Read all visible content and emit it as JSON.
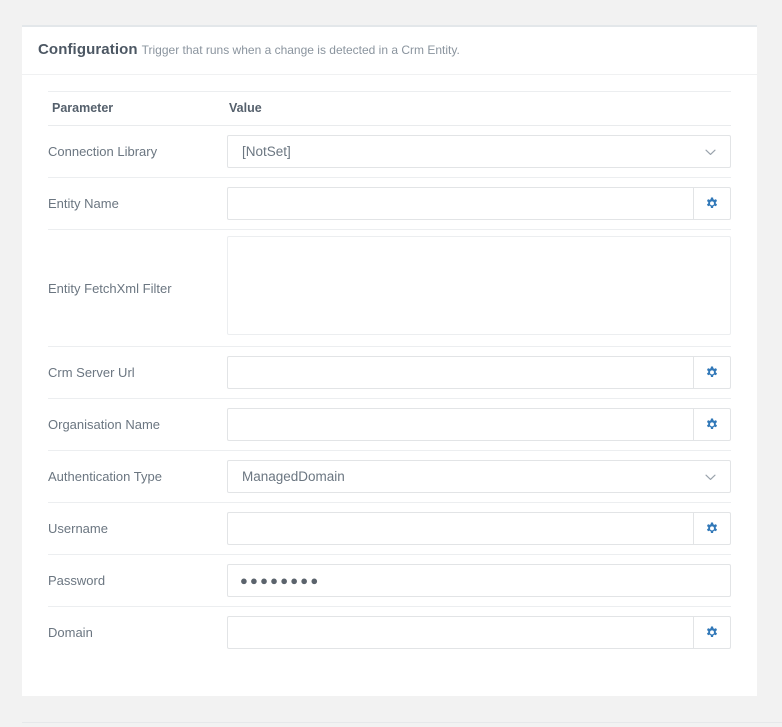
{
  "panel": {
    "title": "Configuration",
    "subtitle": "Trigger that runs when a change is detected in a Crm Entity."
  },
  "table": {
    "headers": {
      "parameter": "Parameter",
      "value": "Value"
    },
    "rows": [
      {
        "label": "Connection Library",
        "control": "select",
        "value": "[NotSet]",
        "icon": "chevron-down-icon"
      },
      {
        "label": "Entity Name",
        "control": "input-with-button",
        "value": "",
        "placeholder": "",
        "icon": "gear-icon"
      },
      {
        "label": "Entity FetchXml Filter",
        "control": "textarea",
        "value": "",
        "placeholder": ""
      },
      {
        "label": "Crm Server Url",
        "control": "input-with-button",
        "value": "",
        "placeholder": "",
        "icon": "gear-icon"
      },
      {
        "label": "Organisation Name",
        "control": "input-with-button",
        "value": "",
        "placeholder": "",
        "icon": "gear-icon"
      },
      {
        "label": "Authentication Type",
        "control": "select",
        "value": "ManagedDomain",
        "icon": "chevron-down-icon"
      },
      {
        "label": "Username",
        "control": "input-with-button",
        "value": "",
        "placeholder": "",
        "icon": "gear-icon"
      },
      {
        "label": "Password",
        "control": "password",
        "value": "●●●●●●●●"
      },
      {
        "label": "Domain",
        "control": "input-with-button",
        "value": "",
        "placeholder": "",
        "icon": "gear-icon"
      }
    ]
  },
  "colors": {
    "page_background": "#f2f2f2",
    "panel_background": "#ffffff",
    "panel_top_border": "#e3e7ea",
    "title_text": "#4c5763",
    "subtitle_text": "#8a949e",
    "label_text": "#6b7681",
    "header_text": "#55606c",
    "border": "#e2e4e6",
    "gear_icon": "#3178b8",
    "chevron_icon": "#9aa3ac"
  }
}
